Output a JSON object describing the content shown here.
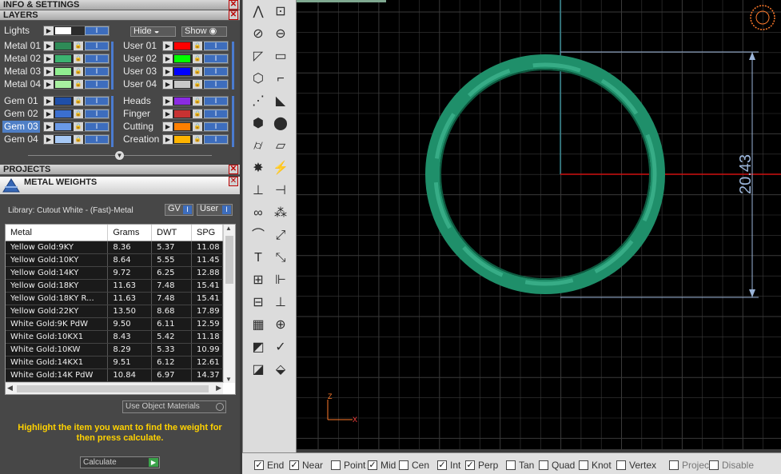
{
  "info_header": "INFO & SETTINGS",
  "layers_header": "LAYERS",
  "lights_label": "Lights",
  "hide_label": "Hide",
  "show_label": "Show",
  "metal_layers": [
    {
      "name": "Metal 01",
      "color": "#2e8b57"
    },
    {
      "name": "Metal 02",
      "color": "#3cb371"
    },
    {
      "name": "Metal 03",
      "color": "#90ee90"
    },
    {
      "name": "Metal 04",
      "color": "#a8f0a0"
    }
  ],
  "user_layers": [
    {
      "name": "User 01",
      "color": "#ff0000"
    },
    {
      "name": "User 02",
      "color": "#00ff00"
    },
    {
      "name": "User 03",
      "color": "#0000ff"
    },
    {
      "name": "User 04",
      "color": "#c8c8c8"
    }
  ],
  "gem_layers": [
    {
      "name": "Gem 01",
      "color": "#1f4fa8"
    },
    {
      "name": "Gem 02",
      "color": "#3b6fd0"
    },
    {
      "name": "Gem 03",
      "color": "#6a9ae8"
    },
    {
      "name": "Gem 04",
      "color": "#a6c8f5"
    }
  ],
  "other_layers": [
    {
      "name": "Heads",
      "color": "#8a2be2"
    },
    {
      "name": "Finger",
      "color": "#c83232"
    },
    {
      "name": "Cutting",
      "color": "#ff7f00"
    },
    {
      "name": "Creation",
      "color": "#ffb400"
    }
  ],
  "selected_layer": "Gem 03",
  "projects_header": "PROJECTS",
  "metal_weights_title": "METAL WEIGHTS",
  "library_label": "Library: Cutout White - (Fast)-Metal",
  "gv_label": "GV",
  "user_label": "User",
  "table": {
    "headers": [
      "Metal",
      "Grams",
      "DWT",
      "SPG"
    ],
    "rows": [
      [
        "Yellow Gold:9KY",
        "8.36",
        "5.37",
        "11.08"
      ],
      [
        "Yellow Gold:10KY",
        "8.64",
        "5.55",
        "11.45"
      ],
      [
        "Yellow Gold:14KY",
        "9.72",
        "6.25",
        "12.88"
      ],
      [
        "Yellow Gold:18KY",
        "11.63",
        "7.48",
        "15.41"
      ],
      [
        "Yellow Gold:18KY R...",
        "11.63",
        "7.48",
        "15.41"
      ],
      [
        "Yellow Gold:22KY",
        "13.50",
        "8.68",
        "17.89"
      ],
      [
        "White Gold:9K PdW",
        "9.50",
        "6.11",
        "12.59"
      ],
      [
        "White Gold:10KX1",
        "8.43",
        "5.42",
        "11.18"
      ],
      [
        "White Gold:10KW",
        "8.29",
        "5.33",
        "10.99"
      ],
      [
        "White Gold:14KX1",
        "9.51",
        "6.12",
        "12.61"
      ],
      [
        "White Gold:14K PdW",
        "10.84",
        "6.97",
        "14.37"
      ]
    ]
  },
  "use_object_materials": "Use Object Materials",
  "hint_text": "Highlight the item you want to find the weight for then press calculate.",
  "calculate_label": "Calculate",
  "dimension_label": "20.43",
  "axis_x": "X",
  "axis_z": "Z",
  "snaps": [
    {
      "label": "End",
      "checked": true
    },
    {
      "label": "Near",
      "checked": true
    },
    {
      "label": "Point",
      "checked": false
    },
    {
      "label": "Mid",
      "checked": true
    },
    {
      "label": "Cen",
      "checked": false
    },
    {
      "label": "Int",
      "checked": true
    },
    {
      "label": "Perp",
      "checked": true
    },
    {
      "label": "Tan",
      "checked": false
    },
    {
      "label": "Quad",
      "checked": false
    },
    {
      "label": "Knot",
      "checked": false
    },
    {
      "label": "Vertex",
      "checked": false
    },
    {
      "label": "Project",
      "checked": false,
      "disabled": true
    },
    {
      "label": "Disable",
      "checked": false,
      "disabled": true
    }
  ],
  "tool_icons": [
    "polyline-icon",
    "curve-points-icon",
    "circle-icon",
    "ellipse-icon",
    "arc-icon",
    "rectangle-icon",
    "polygon-icon",
    "fillet-curve-icon",
    "control-points-icon",
    "surface-patch-icon",
    "box-icon",
    "sphere-icon",
    "cylinder-icon",
    "plane-surface-icon",
    "explode-icon",
    "lightning-icon",
    "trim-icon",
    "split-icon",
    "boolean-icon",
    "array-icon",
    "offset-curve-icon",
    "rebuild-curve-icon",
    "text-icon",
    "scale-icon",
    "group-icon",
    "mirror-icon",
    "cube-view-icon",
    "dimension-icon",
    "grid-array-icon",
    "align-icon",
    "extrude-icon",
    "check-icon",
    "gem-solid-icon",
    "render-icon"
  ],
  "colors": {
    "ring": "#1f8f6a",
    "grid": "#3a3a3a",
    "axis_red": "#d01010",
    "axis_cyan": "#3fb8c8",
    "dimension": "#9ab4d8",
    "accent": "#3d6dbd",
    "hint": "#ffd200"
  }
}
